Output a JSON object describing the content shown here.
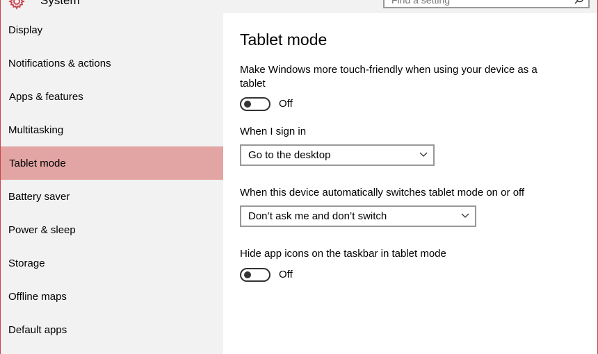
{
  "window": {
    "app_title": "System"
  },
  "search": {
    "placeholder": "Find a setting",
    "icon": "search-icon"
  },
  "sidebar": {
    "items": [
      {
        "label": "Display"
      },
      {
        "label": "Notifications & actions"
      },
      {
        "label": "Apps & features"
      },
      {
        "label": "Multitasking"
      },
      {
        "label": "Tablet mode",
        "selected": true
      },
      {
        "label": "Battery saver"
      },
      {
        "label": "Power & sleep"
      },
      {
        "label": "Storage"
      },
      {
        "label": "Offline maps"
      },
      {
        "label": "Default apps"
      }
    ]
  },
  "main": {
    "title": "Tablet mode",
    "touch_friendly": {
      "label": "Make Windows more touch-friendly when using your device as a tablet",
      "state": "Off"
    },
    "sign_in": {
      "label": "When I sign in",
      "value": "Go to the desktop"
    },
    "auto_switch": {
      "label": "When this device automatically switches tablet mode on or off",
      "value": "Don’t ask me and don’t switch"
    },
    "hide_icons": {
      "label": "Hide app icons on the taskbar in tablet mode",
      "state": "Off"
    }
  },
  "colors": {
    "accent": "#c8414b",
    "selected_bg": "#e3a4a4",
    "sidebar_bg": "#f2f2f2"
  }
}
